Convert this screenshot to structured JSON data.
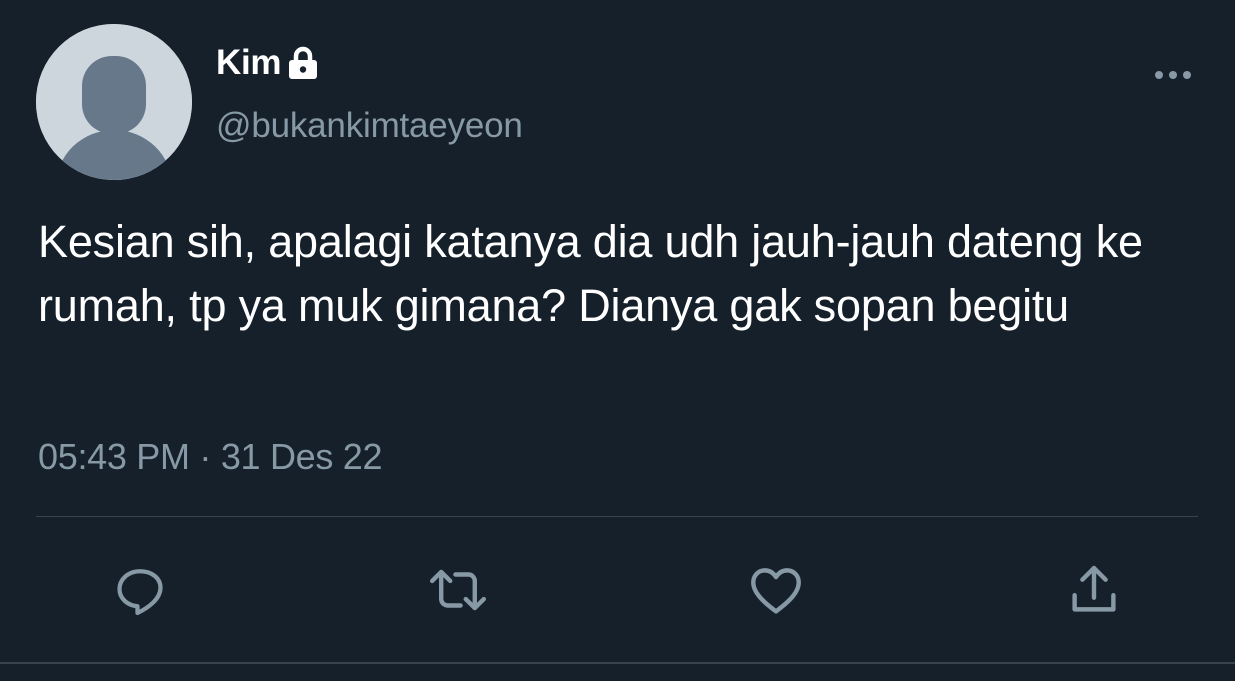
{
  "user": {
    "display_name": "Kim",
    "handle": "@bukankimtaeyeon",
    "protected_icon": "lock-icon",
    "avatar": "default-avatar"
  },
  "tweet": {
    "text": "Kesian sih, apalagi katanya dia udh jauh-jauh dateng ke rumah, tp ya muk gimana? Dianya gak sopan begitu",
    "time": "05:43 PM",
    "separator": "·",
    "date": "31 Des 22"
  },
  "actions": [
    {
      "name": "reply",
      "icon": "reply-icon"
    },
    {
      "name": "retweet",
      "icon": "retweet-icon"
    },
    {
      "name": "like",
      "icon": "heart-icon"
    },
    {
      "name": "share",
      "icon": "share-icon"
    }
  ],
  "menu_icon": "more-icon",
  "colors": {
    "background": "#15202b",
    "primary_text": "#ffffff",
    "secondary_text": "#8899a6",
    "divider": "#38444d",
    "avatar_bg": "#cdd6dd",
    "avatar_figure": "#66788a"
  }
}
